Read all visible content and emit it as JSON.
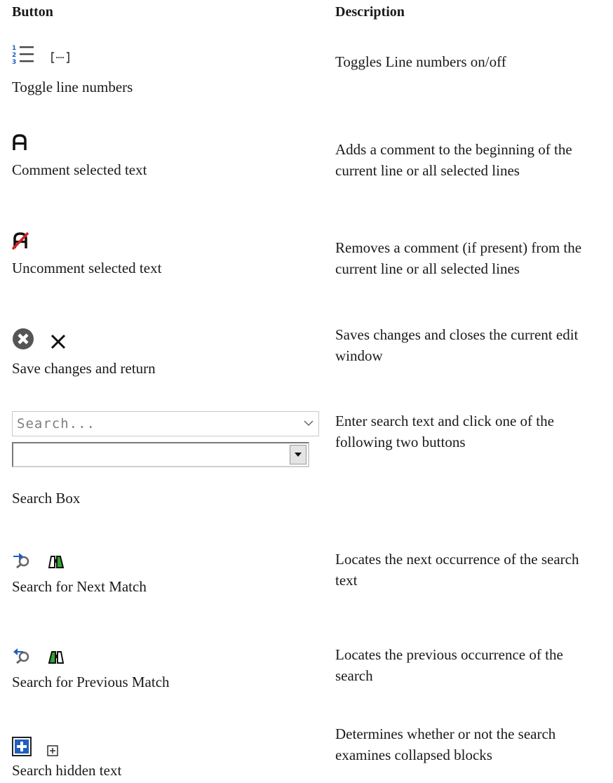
{
  "headers": {
    "button": "Button",
    "description": "Description"
  },
  "rows": [
    {
      "label": "Toggle line numbers",
      "description": "Toggles Line numbers on/off",
      "icons": [
        "line-numbers-icon",
        "bracket-ellipsis-icon"
      ]
    },
    {
      "label": "Comment selected text",
      "description": "Adds a comment to the beginning of the current line or all selected lines",
      "icons": [
        "comment-icon"
      ]
    },
    {
      "label": "Uncomment selected text",
      "description": "Removes a comment (if present) from the current line or all selected lines",
      "icons": [
        "uncomment-icon"
      ]
    },
    {
      "label": "Save changes and return",
      "description": "Saves changes and closes the current edit window",
      "icons": [
        "close-circle-icon",
        "close-x-icon"
      ]
    },
    {
      "label": "Search Box",
      "description": "Enter search text and click one of the following two buttons",
      "search_placeholder": "Search..."
    },
    {
      "label": "Search for Next Match",
      "description": "Locates the next occurrence of the search text",
      "icons": [
        "search-next-icon",
        "binoculars-next-icon"
      ]
    },
    {
      "label": "Search for Previous Match",
      "description": "Locates the previous occurrence of the search",
      "icons": [
        "search-previous-icon",
        "binoculars-previous-icon"
      ]
    },
    {
      "label": "Search hidden text",
      "description": "Determines whether or not the search examines collapsed blocks",
      "icons": [
        "expand-plus-icon",
        "small-plus-icon"
      ]
    }
  ],
  "colors": {
    "accent_blue": "#1f5fbf",
    "red": "#d42020",
    "green": "#2ea82e",
    "gray_icon": "#555555"
  }
}
